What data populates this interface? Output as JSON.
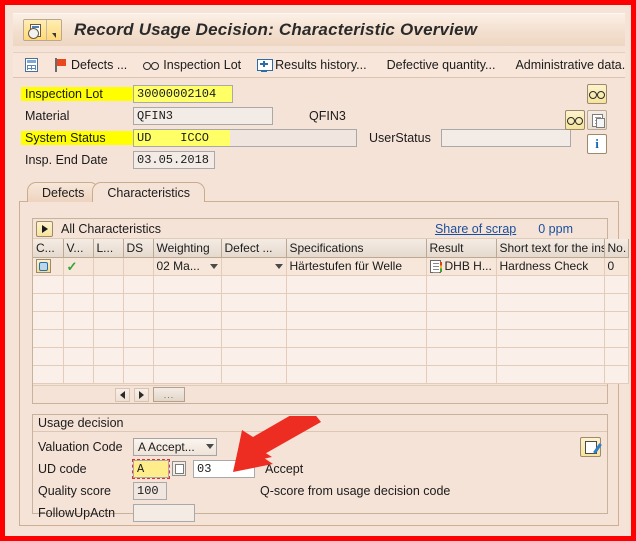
{
  "window": {
    "title": "Record Usage Decision: Characteristic Overview",
    "app_icon": "sap-transaction-icon",
    "dropdown_icon": "chevron-down-icon"
  },
  "toolbar": {
    "items": [
      {
        "label": "",
        "icon": "grid-table-icon"
      },
      {
        "label": "Defects ...",
        "icon": "red-flag-icon"
      },
      {
        "label": "Inspection Lot",
        "icon": "glasses-icon"
      },
      {
        "label": "Results history...",
        "icon": "monitor-plus-icon"
      },
      {
        "label": "Defective quantity...",
        "icon": ""
      },
      {
        "label": "Administrative data.",
        "icon": ""
      }
    ]
  },
  "header_form": {
    "fields": [
      {
        "label": "Inspection Lot",
        "value": "30000002104",
        "highlighted": true
      },
      {
        "label": "Material",
        "value": "QFIN3",
        "highlighted": false,
        "side_text": "QFIN3"
      },
      {
        "label": "System Status",
        "value": "UD    ICCO",
        "highlighted": true
      },
      {
        "label": "Insp. End Date",
        "value": "03.05.2018",
        "highlighted": false
      }
    ],
    "user_status": {
      "label": "UserStatus",
      "value": ""
    },
    "side_buttons": [
      {
        "icon": "glasses-icon",
        "name": "glasses-button-top"
      },
      {
        "icon": "glasses-icon",
        "name": "glasses-button-left"
      },
      {
        "icon": "document-icon",
        "name": "document-button"
      },
      {
        "icon": "info-icon",
        "name": "info-button"
      }
    ]
  },
  "tabs": [
    {
      "label": "Defects",
      "active": false
    },
    {
      "label": "Characteristics",
      "active": true
    }
  ],
  "characteristics": {
    "expand_icon": "play-triangle-icon",
    "title": "All Characteristics",
    "share_of_scrap_link": "Share of scrap",
    "ppm_value": "0 ppm",
    "columns": [
      "C...",
      "V...",
      "L...",
      "DS",
      "Weighting",
      "Defect ...",
      "Specifications",
      "Result",
      "Short text for the insp...",
      "No."
    ],
    "rows": [
      {
        "c_icon": "magnifier-grid-icon",
        "v_icon": "green-check-icon",
        "l": "",
        "ds": "",
        "weighting": "02  Ma...",
        "weighting_caret": "chevron-down-icon",
        "defect": "",
        "defect_caret": "chevron-down-icon",
        "specifications": "Härtestufen für Welle",
        "result_icon": "list-document-icon",
        "result": "DHB H...",
        "short_text": "Hardness Check",
        "no": "0"
      }
    ],
    "empty_row_count": 6,
    "nav": {
      "prev_icon": "arrow-left-icon",
      "next_icon": "arrow-right-icon",
      "more_label": "..."
    }
  },
  "usage_decision": {
    "title": "Usage decision",
    "valuation_code": {
      "label": "Valuation Code",
      "value": "A Accept...",
      "caret": "chevron-down-icon"
    },
    "ud_code": {
      "label": "UD code",
      "value": "A",
      "copy_icon": "copy-icon",
      "second_value": "03",
      "hint": "Accept"
    },
    "quality_score": {
      "label": "Quality score",
      "value": "100",
      "hint": "Q-score from usage decision code"
    },
    "follow_up_action": {
      "label": "FollowUpActn",
      "value": ""
    },
    "edit_button_icon": "edit-pencil-icon"
  },
  "annotation": {
    "arrow": "red-arrow-pointing-to-valuation-code",
    "color": "#ee2d22"
  },
  "colors": {
    "border": "#ff0000",
    "background": "#f6e3d7",
    "highlight": "#ffff00",
    "link": "#1b4f9c",
    "accent_yellow": "#f6e49d"
  }
}
